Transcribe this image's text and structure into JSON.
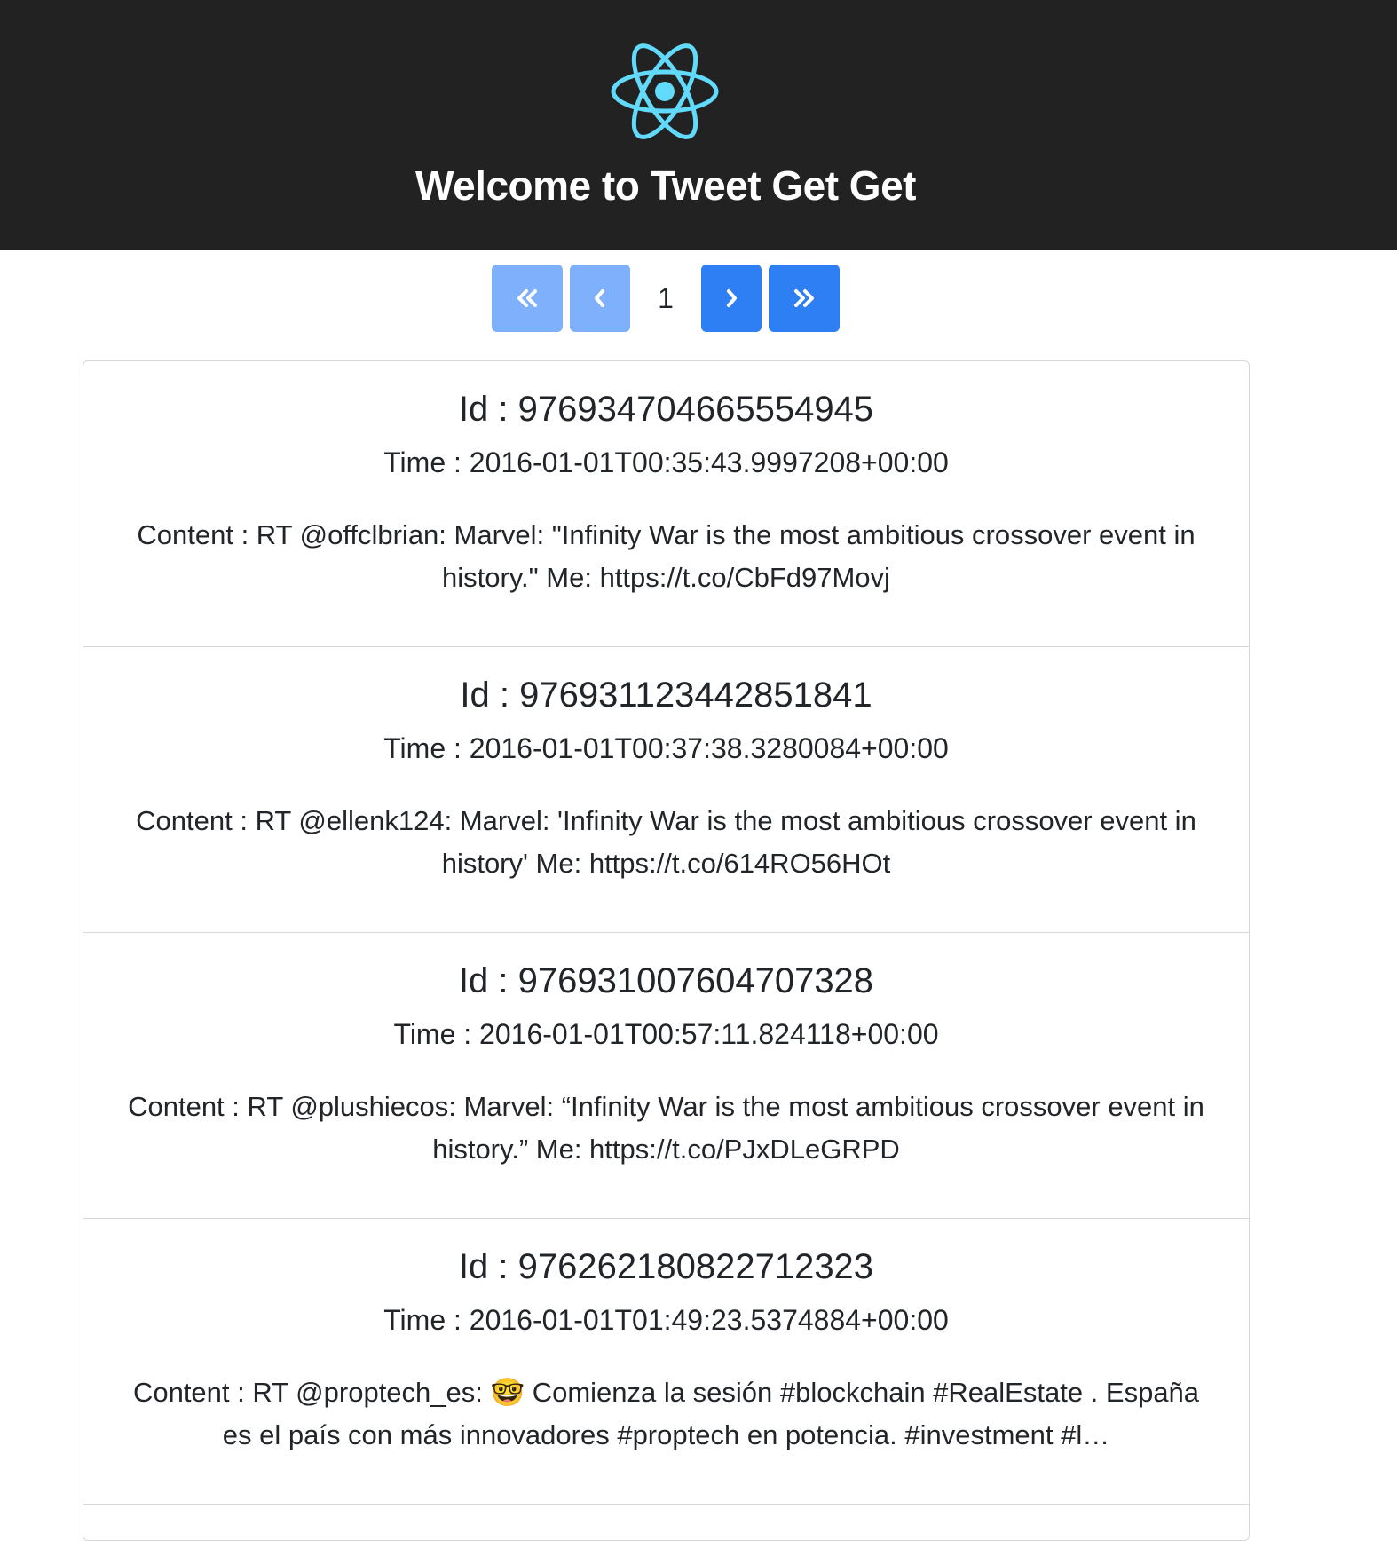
{
  "header": {
    "logo_icon": "react-atom-icon",
    "logo_color": "#61dafb",
    "title": "Welcome to Tweet Get Get"
  },
  "pagination": {
    "first_icon": "double-chevron-left-icon",
    "prev_icon": "chevron-left-icon",
    "current_page": "1",
    "next_icon": "chevron-right-icon",
    "last_icon": "double-chevron-right-icon",
    "disabled_color": "#7fb0fc",
    "active_color": "#2f7ff4"
  },
  "tweets": [
    {
      "id_text": "Id : 976934704665554945",
      "time_text": "Time : 2016-01-01T00:35:43.9997208+00:00",
      "content_text": "Content : RT @offclbrian: Marvel: \"Infinity War is the most ambitious crossover event in history.\" Me: https://t.co/CbFd97Movj"
    },
    {
      "id_text": "Id : 976931123442851841",
      "time_text": "Time : 2016-01-01T00:37:38.3280084+00:00",
      "content_text": "Content : RT @ellenk124: Marvel: 'Infinity War is the most ambitious crossover event in history' Me: https://t.co/614RO56HOt"
    },
    {
      "id_text": "Id : 976931007604707328",
      "time_text": "Time : 2016-01-01T00:57:11.824118+00:00",
      "content_text": "Content : RT @plushiecos: Marvel: “Infinity War is the most ambitious crossover event in history.” Me: https://t.co/PJxDLeGRPD"
    },
    {
      "id_text": "Id : 976262180822712323",
      "time_text": "Time : 2016-01-01T01:49:23.5374884+00:00",
      "content_text": "Content : RT @proptech_es: 🤓  Comienza la sesión #blockchain #RealEstate . España es el país con más innovadores #proptech en potencia. #investment #l…"
    }
  ]
}
